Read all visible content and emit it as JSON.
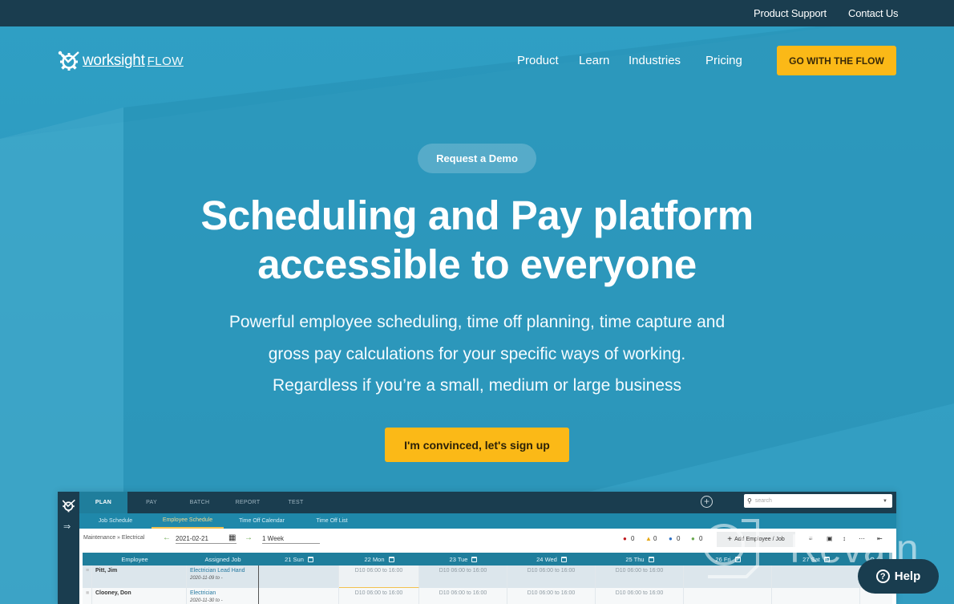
{
  "topbar": {
    "links": [
      "Product Support",
      "Contact Us"
    ]
  },
  "brand": {
    "name": "worksight",
    "suffix": "FLOW"
  },
  "nav": {
    "items": [
      "Product",
      "Learn",
      "Industries",
      "Pricing"
    ],
    "cta": "GO WITH THE FLOW"
  },
  "hero": {
    "pill": "Request a Demo",
    "headline_line1": "Scheduling and Pay platform",
    "headline_line2": "accessible to everyone",
    "sub_line1": "Powerful employee scheduling, time off planning, time capture and",
    "sub_line2": "gross pay calculations for your specific ways of working.",
    "sub_line3": "Regardless if you’re a small, medium or large business",
    "cta": "I'm convinced, let's sign up"
  },
  "app": {
    "tabs": [
      "PLAN",
      "PAY",
      "BATCH",
      "REPORT",
      "TEST"
    ],
    "active_tab": "PLAN",
    "subtabs": [
      "Job Schedule",
      "Employee Schedule",
      "Time Off Calendar",
      "Time Off List"
    ],
    "active_subtab": "Employee Schedule",
    "search_placeholder": "search",
    "breadcrumb": "Maintenance » Electrical",
    "date": "2021-02-21",
    "range": "1 Week",
    "status_counts": {
      "error": "0",
      "warning": "0",
      "info": "0",
      "ok": "0"
    },
    "add_button": "Add Employee / Job",
    "columns": [
      "Employee",
      "Assigned Job",
      "21 Sun",
      "22 Mon",
      "23 Tue",
      "24 Wed",
      "25 Thu",
      "26 Fri",
      "27 Sat"
    ],
    "rows": [
      {
        "employee": "Pitt, Jim",
        "job": "Electrician Lead Hand",
        "job_dates": "2020-11-09 to -",
        "shifts": [
          "",
          "D10 06:00 to 16:00",
          "D10 06:00 to 16:00",
          "D10 06:00 to 16:00",
          "D10 06:00 to 16:00",
          "",
          ""
        ]
      },
      {
        "employee": "Clooney, Don",
        "job": "Electrician",
        "job_dates": "2020-11-30 to -",
        "shifts": [
          "",
          "D10 06:00 to 16:00",
          "D10 06:00 to 16:00",
          "D10 06:00 to 16:00",
          "D10 06:00 to 16:00",
          "",
          ""
        ]
      }
    ]
  },
  "watermark": "Revain",
  "help": "Help",
  "colors": {
    "dark": "#1a3d4f",
    "hero": "#2a97bb",
    "accent": "#fbb917",
    "app_teal": "#1f7e9c"
  }
}
